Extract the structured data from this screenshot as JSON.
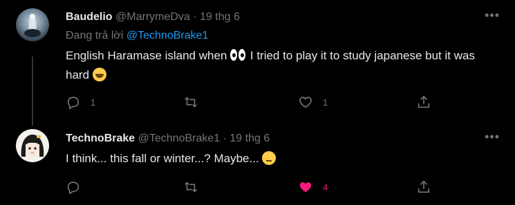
{
  "tweets": [
    {
      "author_name": "Baudelio",
      "handle": "@MarrymeDva",
      "separator": "·",
      "date": "19 thg 6",
      "more_icon": "more-dots-icon",
      "reply_prefix": "Đang trả lời",
      "reply_handle": "@TechnoBrake1",
      "text_part1": "English Haramase island when",
      "text_part2": " I tried to play it  to study japanese but it was hard ",
      "emojis": [
        "eyes-emoji",
        "rolling-laughing-emoji"
      ],
      "reply_count": "1",
      "retweet_count": "",
      "like_count": "1",
      "liked": false
    },
    {
      "author_name": "TechnoBrake",
      "handle": "@TechnoBrake1",
      "separator": "·",
      "date": "19 thg 6",
      "more_icon": "more-dots-icon",
      "text": "I think... this fall or winter...? Maybe...",
      "emojis": [
        "thinking-emoji"
      ],
      "reply_count": "",
      "retweet_count": "",
      "like_count": "4",
      "liked": true
    }
  ],
  "colors": {
    "background": "#000000",
    "text": "#e7e9ea",
    "muted": "#71767b",
    "link": "#1d9bf0",
    "like_active": "#f91880",
    "thread_line": "#333639"
  }
}
